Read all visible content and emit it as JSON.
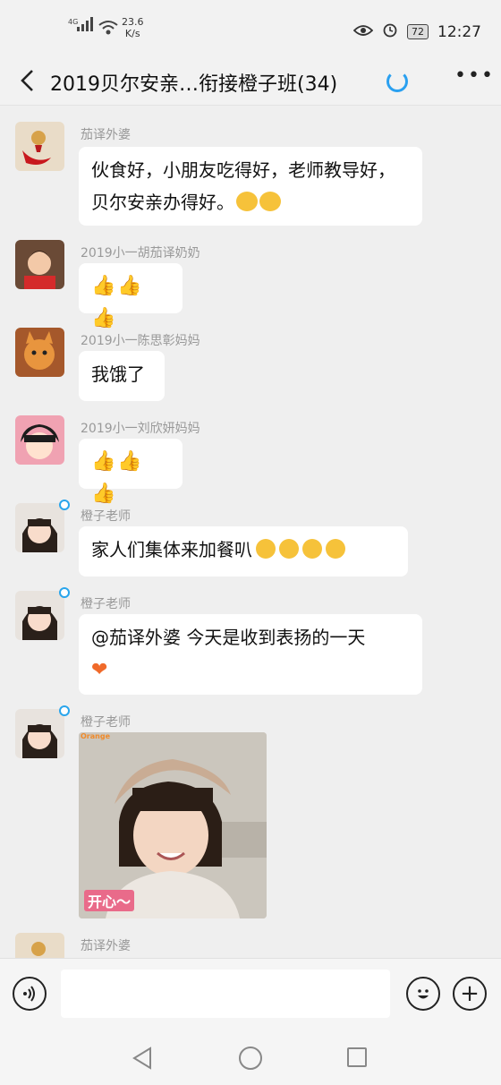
{
  "status_bar": {
    "signal": "⁴ᴳ",
    "speed_value": "23.6",
    "speed_unit": "K/s",
    "battery": "72",
    "time": "12:27"
  },
  "header": {
    "title": "2019贝尔安亲…衔接橙子班(34)"
  },
  "messages": [
    {
      "sender": "茄译外婆",
      "text": "伙食好，小朋友吃得好，老师教导好，贝尔安亲办得好。"
    },
    {
      "sender": "2019小一胡茄译奶奶",
      "text": "👍👍👍"
    },
    {
      "sender": "2019小一陈思彰妈妈",
      "text": "我饿了"
    },
    {
      "sender": "2019小一刘欣妍妈妈",
      "text": "👍👍👍"
    },
    {
      "sender": "橙子老师",
      "text": "家人们集体来加餐叭"
    },
    {
      "sender": "橙子老师",
      "text": "@茄译外婆  今天是收到表扬的一天"
    },
    {
      "sender": "橙子老师",
      "photo_brand": "Orange",
      "photo_caption": "开心～"
    },
    {
      "sender": "茄译外婆"
    }
  ],
  "input": {
    "placeholder": ""
  },
  "colors": {
    "background": "#efefef",
    "accent": "#2aa0f0"
  }
}
